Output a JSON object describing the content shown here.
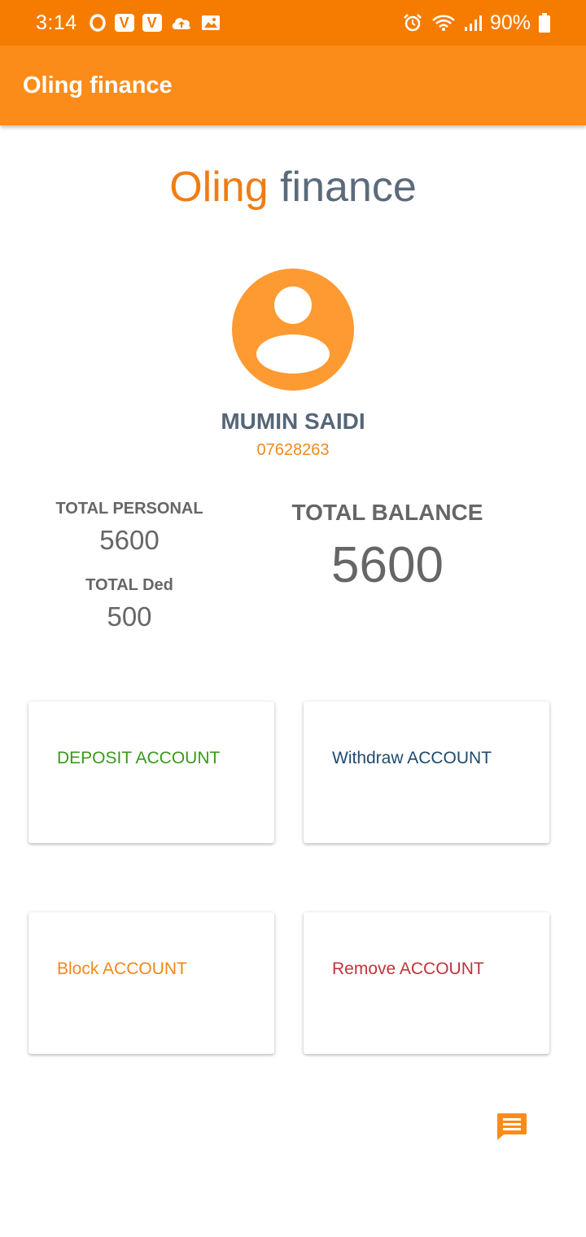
{
  "status_bar": {
    "time": "3:14",
    "battery": "90%",
    "icons": [
      "opera-icon",
      "v-app-icon",
      "v-app-icon",
      "cloud-upload-icon",
      "image-icon",
      "alarm-icon",
      "wifi-icon",
      "signal-icon",
      "battery-icon"
    ],
    "v_badge_letter": "V"
  },
  "app_bar": {
    "title": "Oling finance",
    "color": "#fb8c1a"
  },
  "brand": {
    "part1": "Oling",
    "part2": "finance"
  },
  "profile": {
    "name": "MUMIN SAIDI",
    "phone": "07628263"
  },
  "stats": {
    "personal_label": "TOTAL PERSONAL",
    "personal_value": "5600",
    "ded_label": "TOTAL Ded",
    "ded_value": "500",
    "balance_label": "TOTAL BALANCE",
    "balance_value": "5600"
  },
  "actions": {
    "deposit": {
      "label": "DEPOSIT ACCOUNT",
      "color": "#3a9a1a"
    },
    "withdraw": {
      "label": "Withdraw ACCOUNT",
      "color": "#1f4a6e"
    },
    "block": {
      "label": "Block ACCOUNT",
      "color": "#f0881a"
    },
    "remove": {
      "label": "Remove ACCOUNT",
      "color": "#c0343a"
    }
  },
  "colors": {
    "status_bar": "#f57c00",
    "accent": "#fd9a32"
  }
}
